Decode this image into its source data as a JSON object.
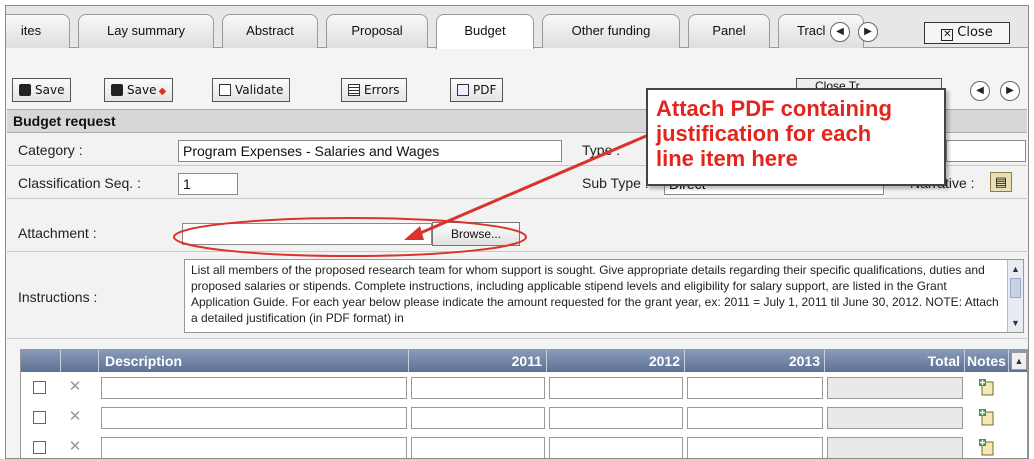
{
  "tabs": [
    {
      "label": "ites",
      "active": false
    },
    {
      "label": "Lay summary",
      "active": false
    },
    {
      "label": "Abstract",
      "active": false
    },
    {
      "label": "Proposal",
      "active": false
    },
    {
      "label": "Budget",
      "active": true
    },
    {
      "label": "Other funding",
      "active": false
    },
    {
      "label": "Panel",
      "active": false
    },
    {
      "label": "Tracl",
      "active": false
    }
  ],
  "tab_nav": {
    "prev_icon": "chevron-left-circle-icon",
    "next_icon": "chevron-right-circle-icon"
  },
  "close_label": "Close",
  "toolbar": {
    "save_label": "Save",
    "save_plus_label": "Save",
    "validate_label": "Validate",
    "errors_label": "Errors",
    "pdf_label": "PDF",
    "hidden_label": "Close Tr..."
  },
  "section": {
    "title": "Budget request"
  },
  "form": {
    "category_label": "Category :",
    "category_value": "Program Expenses - Salaries and Wages",
    "type_label": "Type :",
    "type_value": "",
    "classification_label": "Classification Seq. :",
    "classification_value": "1",
    "subtype_label": "Sub Type :",
    "subtype_value": "Direct",
    "narrative_label": "Narrative :",
    "attachment_label": "Attachment :",
    "attachment_value": "",
    "browse_label": "Browse...",
    "instructions_label": "Instructions :",
    "instructions_text": "List all members of the proposed research team for whom support is sought. Give appropriate details regarding their specific qualifications, duties and proposed salaries or stipends. Complete instructions, including applicable stipend levels and eligibility for salary support, are listed in the Grant Application Guide. For each year below please indicate the amount requested for the grant year, ex: 2011 = July 1, 2011 til June 30, 2012. NOTE: Attach a detailed justification (in PDF format) in"
  },
  "grid": {
    "columns": [
      "Description",
      "2011",
      "2012",
      "2013",
      "Total",
      "Notes"
    ],
    "rows": [
      {
        "description": "",
        "y2011": "",
        "y2012": "",
        "y2013": "",
        "total": ""
      },
      {
        "description": "",
        "y2011": "",
        "y2012": "",
        "y2013": "",
        "total": ""
      },
      {
        "description": "",
        "y2011": "",
        "y2012": "",
        "y2013": "",
        "total": ""
      }
    ]
  },
  "callout": {
    "line1": "Attach PDF containing",
    "line2": "justification for each",
    "line3": "line item here"
  },
  "colors": {
    "callout_text": "#e2251d",
    "annotation": "#d9342b",
    "grid_header": "#6b7ca0"
  }
}
